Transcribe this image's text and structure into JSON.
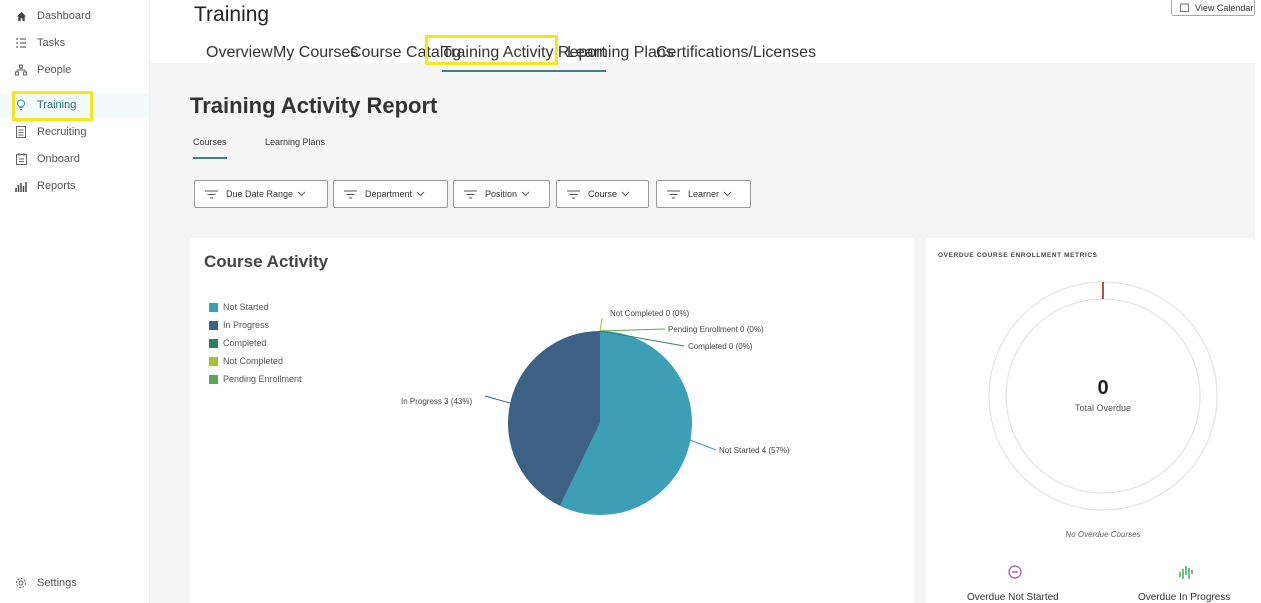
{
  "sidebar": {
    "items": [
      {
        "label": "Dashboard",
        "icon": "home-icon"
      },
      {
        "label": "Tasks",
        "icon": "tasks-icon"
      },
      {
        "label": "People",
        "icon": "people-icon"
      },
      {
        "label": "Training",
        "icon": "lightbulb-icon"
      },
      {
        "label": "Recruiting",
        "icon": "clipboard-icon"
      },
      {
        "label": "Onboard",
        "icon": "onboard-icon"
      },
      {
        "label": "Reports",
        "icon": "bar-chart-icon"
      }
    ],
    "settings_label": "Settings"
  },
  "header": {
    "title": "Training",
    "calendar_button": "View Calendar",
    "tabs": [
      "Overview",
      "My Courses",
      "Course Catalog",
      "Training Activity Report",
      "Learning Plans",
      "Certifications/Licenses"
    ]
  },
  "report": {
    "title": "Training Activity Report",
    "subtabs": [
      "Courses",
      "Learning Plans"
    ],
    "filters": [
      "Due Date Range",
      "Department",
      "Position",
      "Course",
      "Learner"
    ]
  },
  "course_activity": {
    "title": "Course Activity",
    "legend": [
      "Not Started",
      "In Progress",
      "Completed",
      "Not Completed",
      "Pending Enrollment"
    ],
    "colors": {
      "not_started": "#3d9fb5",
      "in_progress": "#3d6085",
      "completed": "#2f8060",
      "not_completed": "#a9bf3c",
      "pending": "#5aa855"
    },
    "labels": {
      "not_completed": "Not Completed 0 (0%)",
      "pending": "Pending Enrollment 0 (0%)",
      "completed": "Completed 0 (0%)",
      "in_progress": "In Progress 3 (43%)",
      "not_started": "Not Started 4 (57%)"
    }
  },
  "chart_data": {
    "type": "pie",
    "categories": [
      "Not Started",
      "In Progress",
      "Completed",
      "Not Completed",
      "Pending Enrollment"
    ],
    "values": [
      4,
      3,
      0,
      0,
      0
    ],
    "percentages": [
      57,
      43,
      0,
      0,
      0
    ],
    "title": "Course Activity",
    "legend_position": "left"
  },
  "overdue": {
    "title": "OVERDUE COURSE ENROLLMENT METRICS",
    "total": "0",
    "total_label": "Total Overdue",
    "empty_text": "No Overdue Courses",
    "not_started_label": "Overdue Not Started",
    "in_progress_label": "Overdue In Progress"
  }
}
